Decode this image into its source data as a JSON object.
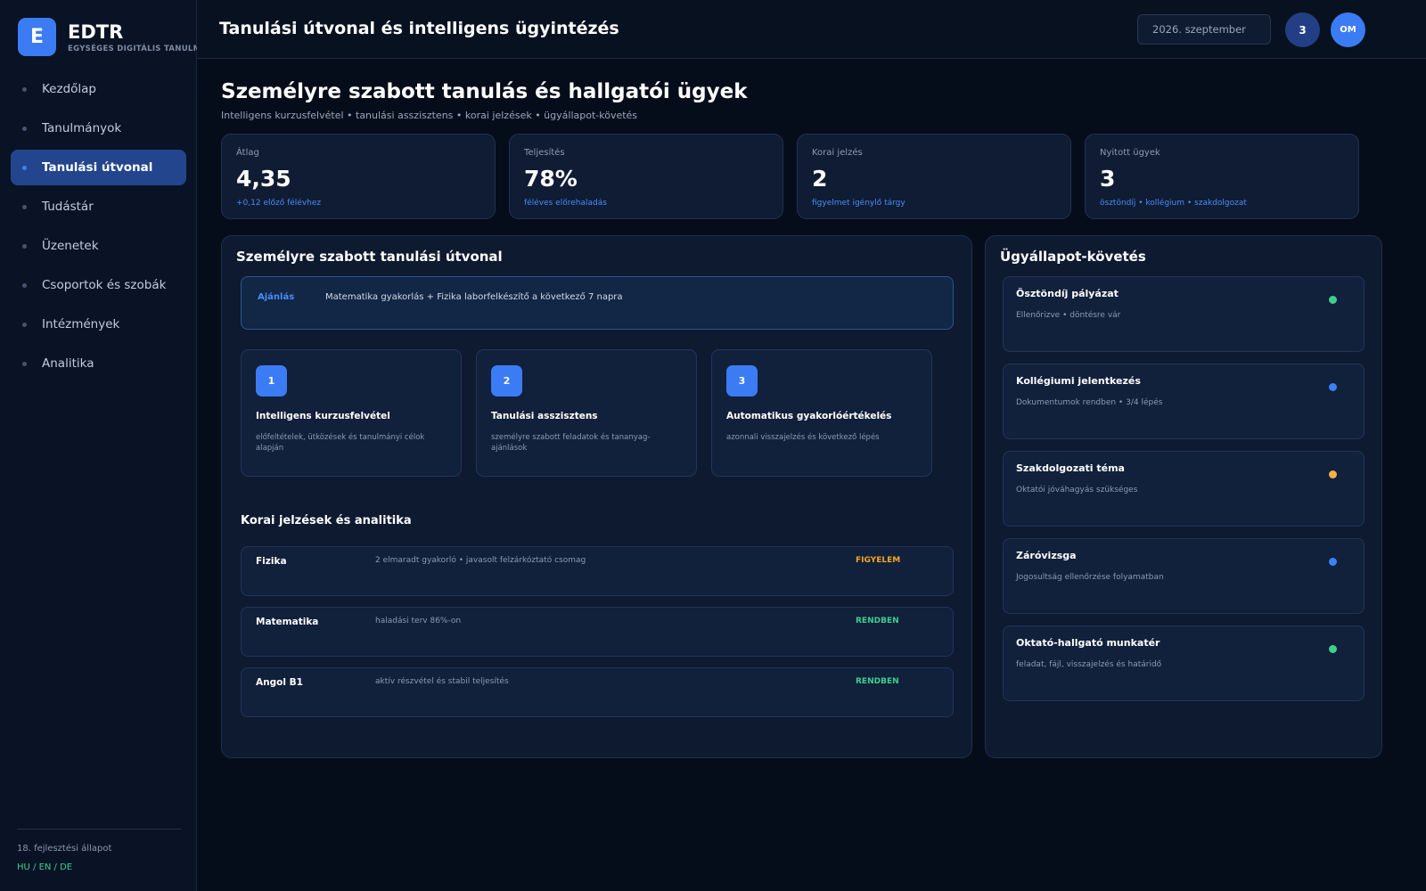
{
  "brand": {
    "logo_letter": "E",
    "name": "EDTR",
    "subtitle": "EGYSÉGES DIGITÁLIS TANULMÁNYI RENDSZER"
  },
  "sidebar": {
    "items": [
      {
        "label": "Kezdőlap",
        "active": false
      },
      {
        "label": "Tanulmányok",
        "active": false
      },
      {
        "label": "Tanulási útvonal",
        "active": true
      },
      {
        "label": "Tudástár",
        "active": false
      },
      {
        "label": "Üzenetek",
        "active": false
      },
      {
        "label": "Csoportok és szobák",
        "active": false
      },
      {
        "label": "Intézmények",
        "active": false
      },
      {
        "label": "Analitika",
        "active": false
      }
    ],
    "footer_status": "18. fejlesztési állapot",
    "footer_lang": "HU / EN / DE"
  },
  "topbar": {
    "title": "Tanulási útvonal és intelligens ügyintézés",
    "date": "2026. szeptember",
    "notification_count": "3",
    "avatar_initials": "OM"
  },
  "main": {
    "title": "Személyre szabott tanulás és hallgatói ügyek",
    "subtitle": "Intelligens kurzusfelvétel • tanulási asszisztens • korai jelzések • ügyállapot-követés"
  },
  "stats": [
    {
      "label": "Átlag",
      "value": "4,35",
      "note": "+0,12 előző félévhez"
    },
    {
      "label": "Teljesítés",
      "value": "78%",
      "note": "féléves előrehaladás"
    },
    {
      "label": "Korai jelzés",
      "value": "2",
      "note": "figyelmet igénylő tárgy"
    },
    {
      "label": "Nyitott ügyek",
      "value": "3",
      "note": "ösztöndíj • kollégium • szakdolgozat"
    }
  ],
  "learning_path": {
    "title": "Személyre szabott tanulási útvonal",
    "recommend_label": "Ajánlás",
    "recommend_text": "Matematika gyakorlás + Fizika laborfelkészítő a következő 7 napra",
    "steps": [
      {
        "num": "1",
        "title": "Intelligens kurzusfelvétel",
        "desc": "előfeltételek, ütközések és tanulmányi célok alapján"
      },
      {
        "num": "2",
        "title": "Tanulási asszisztens",
        "desc": "személyre szabott feladatok és tananyag-ajánlások"
      },
      {
        "num": "3",
        "title": "Automatikus gyakorlóértékelés",
        "desc": "azonnali visszajelzés és következő lépés"
      }
    ],
    "alerts_title": "Korai jelzések és analitika",
    "alerts": [
      {
        "subject": "Fizika",
        "desc": "2 elmaradt gyakorló • javasolt felzárkóztató csomag",
        "status": "FIGYELEM",
        "color": "#f5a623"
      },
      {
        "subject": "Matematika",
        "desc": "haladási terv 86%-on",
        "status": "RENDBEN",
        "color": "#3ecf8e"
      },
      {
        "subject": "Angol B1",
        "desc": "aktív részvétel és stabil teljesítés",
        "status": "RENDBEN",
        "color": "#3ecf8e"
      }
    ]
  },
  "cases": {
    "title": "Ügyállapot-követés",
    "items": [
      {
        "title": "Ösztöndíj pályázat",
        "desc": "Ellenőrizve • döntésre vár",
        "color": "#3ecf8e"
      },
      {
        "title": "Kollégiumi jelentkezés",
        "desc": "Dokumentumok rendben • 3/4 lépés",
        "color": "#3b82f6"
      },
      {
        "title": "Szakdolgozati téma",
        "desc": "Oktatói jóváhagyás szükséges",
        "color": "#f5b04a"
      },
      {
        "title": "Záróvizsga",
        "desc": "Jogosultság ellenőrzése folyamatban",
        "color": "#3b82f6"
      },
      {
        "title": "Oktató-hallgató munkatér",
        "desc": "feladat, fájl, visszajelzés és határidő",
        "color": "#3ecf8e"
      }
    ]
  }
}
